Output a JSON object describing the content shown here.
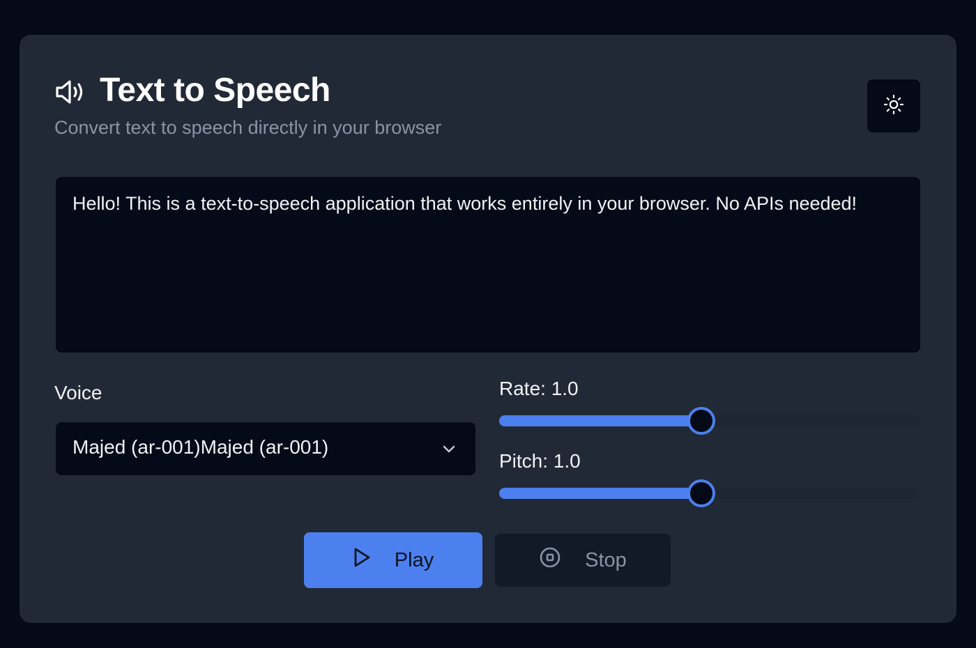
{
  "header": {
    "icon": "speaker-volume-icon",
    "title": "Text to Speech",
    "subtitle": "Convert text to speech directly in your browser",
    "theme_toggle_icon": "sun-icon"
  },
  "editor": {
    "text": "Hello! This is a text-to-speech application that works entirely in your browser. No APIs needed!"
  },
  "voice": {
    "label": "Voice",
    "selected": "Majed (ar-001)Majed (ar-001)",
    "chevron_icon": "chevron-down-icon"
  },
  "rate": {
    "label": "Rate: 1.0",
    "value": 1.0,
    "fraction": 0.5
  },
  "pitch": {
    "label": "Pitch: 1.0",
    "value": 1.0,
    "fraction": 0.5
  },
  "buttons": {
    "play_label": "Play",
    "play_icon": "play-icon",
    "stop_label": "Stop",
    "stop_icon": "stop-circle-icon"
  },
  "colors": {
    "background": "#040a17",
    "card": "#222936",
    "accent": "#4c80ee",
    "muted_text": "#8a94a6"
  }
}
